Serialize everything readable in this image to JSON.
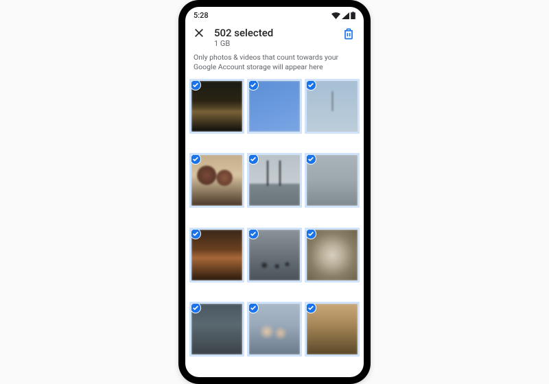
{
  "statusbar": {
    "time": "5:28"
  },
  "header": {
    "title": "502 selected",
    "subtitle": "1 GB"
  },
  "notice": "Only photos & videos that count towards your Google Account storage will appear here",
  "thumbnails": [
    {
      "name": "arch-night",
      "selected": true
    },
    {
      "name": "blue-sky",
      "selected": true
    },
    {
      "name": "sky-pole",
      "selected": true
    },
    {
      "name": "people-selfie",
      "selected": true
    },
    {
      "name": "power-poles",
      "selected": true
    },
    {
      "name": "foggy",
      "selected": true
    },
    {
      "name": "sunset-blur",
      "selected": true
    },
    {
      "name": "street-crossing",
      "selected": true
    },
    {
      "name": "dog-blur",
      "selected": true
    },
    {
      "name": "dusk-silhouette",
      "selected": true
    },
    {
      "name": "kids-blur",
      "selected": true
    },
    {
      "name": "evening-blur",
      "selected": true
    }
  ],
  "colors": {
    "accent": "#1a73e8"
  }
}
